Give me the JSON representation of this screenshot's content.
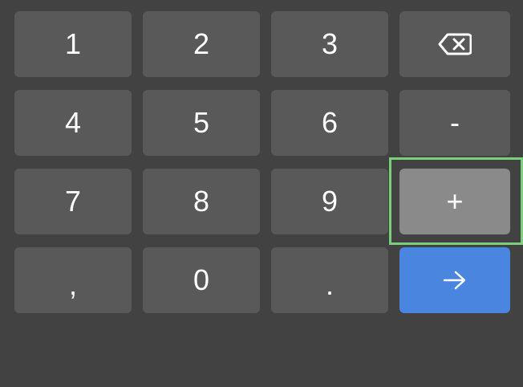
{
  "keypad": {
    "keys": {
      "k1": "1",
      "k2": "2",
      "k3": "3",
      "backspace_icon": "backspace-icon",
      "k4": "4",
      "k5": "5",
      "k6": "6",
      "minus": "-",
      "k7": "7",
      "k8": "8",
      "k9": "9",
      "plus": "+",
      "comma": ",",
      "k0": "0",
      "dot": ".",
      "enter_icon": "arrow-right-icon"
    },
    "focused_key": "plus",
    "colors": {
      "background": "#424242",
      "key": "#595959",
      "key_focused": "#8a8a8a",
      "enter": "#4a86e0",
      "focus_ring": "#7ad07a",
      "text": "#ffffff"
    }
  }
}
